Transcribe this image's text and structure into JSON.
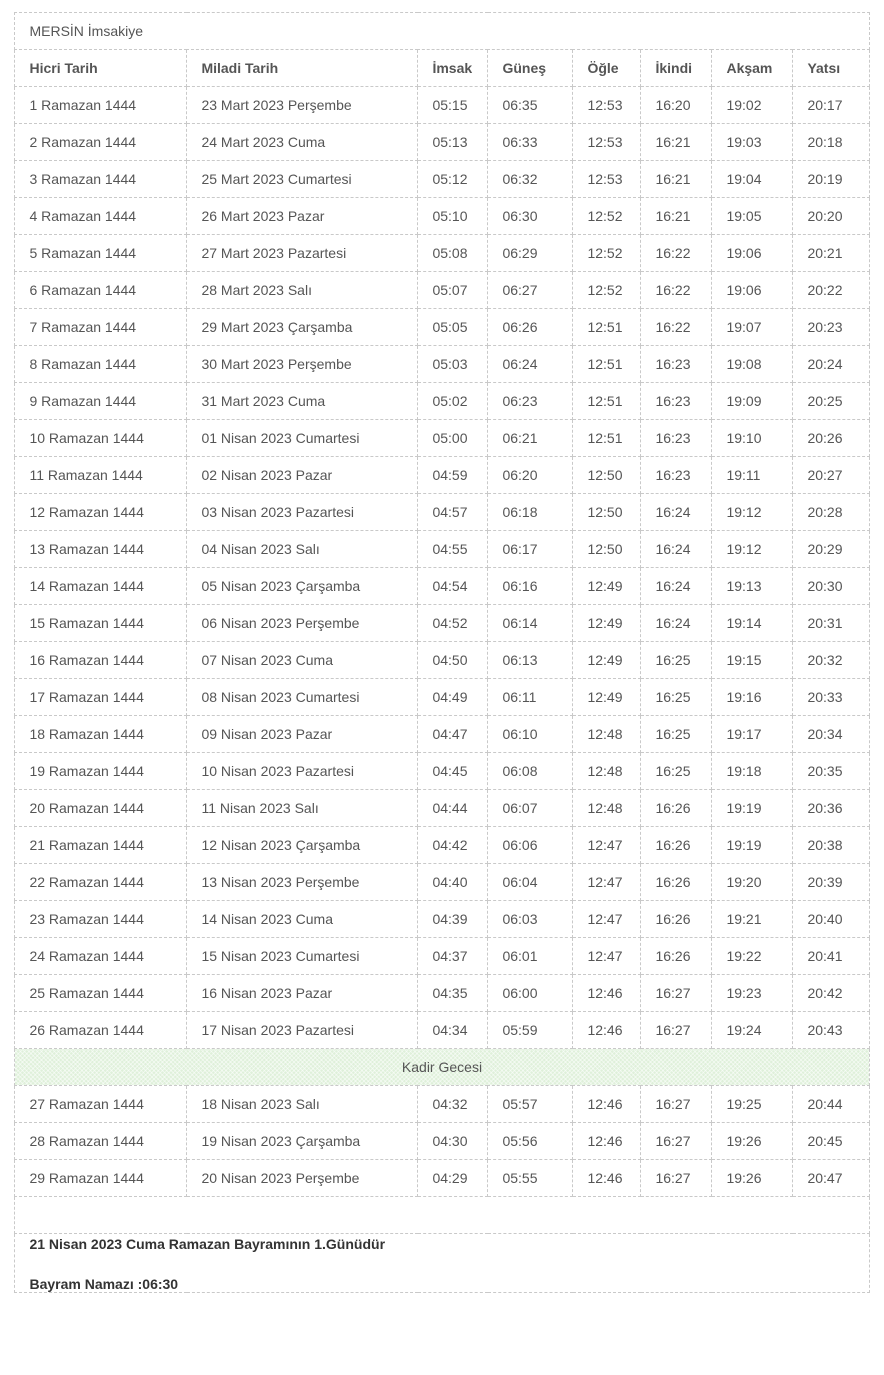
{
  "page": {
    "title": "MERSİN İmsakiye"
  },
  "table": {
    "columns": [
      "Hicri Tarih",
      "Miladi Tarih",
      "İmsak",
      "Güneş",
      "Öğle",
      "İkindi",
      "Akşam",
      "Yatsı"
    ],
    "rows": [
      {
        "hicri": "1 Ramazan 1444",
        "miladi": "23 Mart 2023 Perşembe",
        "imsak": "05:15",
        "gunes": "06:35",
        "ogle": "12:53",
        "ikindi": "16:20",
        "aksam": "19:02",
        "yatsi": "20:17"
      },
      {
        "hicri": "2 Ramazan 1444",
        "miladi": "24 Mart 2023 Cuma",
        "imsak": "05:13",
        "gunes": "06:33",
        "ogle": "12:53",
        "ikindi": "16:21",
        "aksam": "19:03",
        "yatsi": "20:18"
      },
      {
        "hicri": "3 Ramazan 1444",
        "miladi": "25 Mart 2023 Cumartesi",
        "imsak": "05:12",
        "gunes": "06:32",
        "ogle": "12:53",
        "ikindi": "16:21",
        "aksam": "19:04",
        "yatsi": "20:19"
      },
      {
        "hicri": "4 Ramazan 1444",
        "miladi": "26 Mart 2023 Pazar",
        "imsak": "05:10",
        "gunes": "06:30",
        "ogle": "12:52",
        "ikindi": "16:21",
        "aksam": "19:05",
        "yatsi": "20:20"
      },
      {
        "hicri": "5 Ramazan 1444",
        "miladi": "27 Mart 2023 Pazartesi",
        "imsak": "05:08",
        "gunes": "06:29",
        "ogle": "12:52",
        "ikindi": "16:22",
        "aksam": "19:06",
        "yatsi": "20:21"
      },
      {
        "hicri": "6 Ramazan 1444",
        "miladi": "28 Mart 2023 Salı",
        "imsak": "05:07",
        "gunes": "06:27",
        "ogle": "12:52",
        "ikindi": "16:22",
        "aksam": "19:06",
        "yatsi": "20:22"
      },
      {
        "hicri": "7 Ramazan 1444",
        "miladi": "29 Mart 2023 Çarşamba",
        "imsak": "05:05",
        "gunes": "06:26",
        "ogle": "12:51",
        "ikindi": "16:22",
        "aksam": "19:07",
        "yatsi": "20:23"
      },
      {
        "hicri": "8 Ramazan 1444",
        "miladi": "30 Mart 2023 Perşembe",
        "imsak": "05:03",
        "gunes": "06:24",
        "ogle": "12:51",
        "ikindi": "16:23",
        "aksam": "19:08",
        "yatsi": "20:24"
      },
      {
        "hicri": "9 Ramazan 1444",
        "miladi": "31 Mart 2023 Cuma",
        "imsak": "05:02",
        "gunes": "06:23",
        "ogle": "12:51",
        "ikindi": "16:23",
        "aksam": "19:09",
        "yatsi": "20:25"
      },
      {
        "hicri": "10 Ramazan 1444",
        "miladi": "01 Nisan 2023 Cumartesi",
        "imsak": "05:00",
        "gunes": "06:21",
        "ogle": "12:51",
        "ikindi": "16:23",
        "aksam": "19:10",
        "yatsi": "20:26"
      },
      {
        "hicri": "11 Ramazan 1444",
        "miladi": "02 Nisan 2023 Pazar",
        "imsak": "04:59",
        "gunes": "06:20",
        "ogle": "12:50",
        "ikindi": "16:23",
        "aksam": "19:11",
        "yatsi": "20:27"
      },
      {
        "hicri": "12 Ramazan 1444",
        "miladi": "03 Nisan 2023 Pazartesi",
        "imsak": "04:57",
        "gunes": "06:18",
        "ogle": "12:50",
        "ikindi": "16:24",
        "aksam": "19:12",
        "yatsi": "20:28"
      },
      {
        "hicri": "13 Ramazan 1444",
        "miladi": "04 Nisan 2023 Salı",
        "imsak": "04:55",
        "gunes": "06:17",
        "ogle": "12:50",
        "ikindi": "16:24",
        "aksam": "19:12",
        "yatsi": "20:29"
      },
      {
        "hicri": "14 Ramazan 1444",
        "miladi": "05 Nisan 2023 Çarşamba",
        "imsak": "04:54",
        "gunes": "06:16",
        "ogle": "12:49",
        "ikindi": "16:24",
        "aksam": "19:13",
        "yatsi": "20:30"
      },
      {
        "hicri": "15 Ramazan 1444",
        "miladi": "06 Nisan 2023 Perşembe",
        "imsak": "04:52",
        "gunes": "06:14",
        "ogle": "12:49",
        "ikindi": "16:24",
        "aksam": "19:14",
        "yatsi": "20:31"
      },
      {
        "hicri": "16 Ramazan 1444",
        "miladi": "07 Nisan 2023 Cuma",
        "imsak": "04:50",
        "gunes": "06:13",
        "ogle": "12:49",
        "ikindi": "16:25",
        "aksam": "19:15",
        "yatsi": "20:32"
      },
      {
        "hicri": "17 Ramazan 1444",
        "miladi": "08 Nisan 2023 Cumartesi",
        "imsak": "04:49",
        "gunes": "06:11",
        "ogle": "12:49",
        "ikindi": "16:25",
        "aksam": "19:16",
        "yatsi": "20:33"
      },
      {
        "hicri": "18 Ramazan 1444",
        "miladi": "09 Nisan 2023 Pazar",
        "imsak": "04:47",
        "gunes": "06:10",
        "ogle": "12:48",
        "ikindi": "16:25",
        "aksam": "19:17",
        "yatsi": "20:34"
      },
      {
        "hicri": "19 Ramazan 1444",
        "miladi": "10 Nisan 2023 Pazartesi",
        "imsak": "04:45",
        "gunes": "06:08",
        "ogle": "12:48",
        "ikindi": "16:25",
        "aksam": "19:18",
        "yatsi": "20:35"
      },
      {
        "hicri": "20 Ramazan 1444",
        "miladi": "11 Nisan 2023 Salı",
        "imsak": "04:44",
        "gunes": "06:07",
        "ogle": "12:48",
        "ikindi": "16:26",
        "aksam": "19:19",
        "yatsi": "20:36"
      },
      {
        "hicri": "21 Ramazan 1444",
        "miladi": "12 Nisan 2023 Çarşamba",
        "imsak": "04:42",
        "gunes": "06:06",
        "ogle": "12:47",
        "ikindi": "16:26",
        "aksam": "19:19",
        "yatsi": "20:38"
      },
      {
        "hicri": "22 Ramazan 1444",
        "miladi": "13 Nisan 2023 Perşembe",
        "imsak": "04:40",
        "gunes": "06:04",
        "ogle": "12:47",
        "ikindi": "16:26",
        "aksam": "19:20",
        "yatsi": "20:39"
      },
      {
        "hicri": "23 Ramazan 1444",
        "miladi": "14 Nisan 2023 Cuma",
        "imsak": "04:39",
        "gunes": "06:03",
        "ogle": "12:47",
        "ikindi": "16:26",
        "aksam": "19:21",
        "yatsi": "20:40"
      },
      {
        "hicri": "24 Ramazan 1444",
        "miladi": "15 Nisan 2023 Cumartesi",
        "imsak": "04:37",
        "gunes": "06:01",
        "ogle": "12:47",
        "ikindi": "16:26",
        "aksam": "19:22",
        "yatsi": "20:41"
      },
      {
        "hicri": "25 Ramazan 1444",
        "miladi": "16 Nisan 2023 Pazar",
        "imsak": "04:35",
        "gunes": "06:00",
        "ogle": "12:46",
        "ikindi": "16:27",
        "aksam": "19:23",
        "yatsi": "20:42"
      },
      {
        "hicri": "26 Ramazan 1444",
        "miladi": "17 Nisan 2023 Pazartesi",
        "imsak": "04:34",
        "gunes": "05:59",
        "ogle": "12:46",
        "ikindi": "16:27",
        "aksam": "19:24",
        "yatsi": "20:43"
      },
      {
        "hicri": "27 Ramazan 1444",
        "miladi": "18 Nisan 2023 Salı",
        "imsak": "04:32",
        "gunes": "05:57",
        "ogle": "12:46",
        "ikindi": "16:27",
        "aksam": "19:25",
        "yatsi": "20:44"
      },
      {
        "hicri": "28 Ramazan 1444",
        "miladi": "19 Nisan 2023 Çarşamba",
        "imsak": "04:30",
        "gunes": "05:56",
        "ogle": "12:46",
        "ikindi": "16:27",
        "aksam": "19:26",
        "yatsi": "20:45"
      },
      {
        "hicri": "29 Ramazan 1444",
        "miladi": "20 Nisan 2023 Perşembe",
        "imsak": "04:29",
        "gunes": "05:55",
        "ogle": "12:46",
        "ikindi": "16:27",
        "aksam": "19:26",
        "yatsi": "20:47"
      }
    ],
    "kadir_row": {
      "label": "Kadir Gecesi",
      "after_row_index": 25,
      "highlight_color": "#dff0da"
    }
  },
  "footer": {
    "line1": "21 Nisan 2023 Cuma Ramazan Bayramının 1.Günüdür",
    "line2": "Bayram Namazı :06:30"
  }
}
